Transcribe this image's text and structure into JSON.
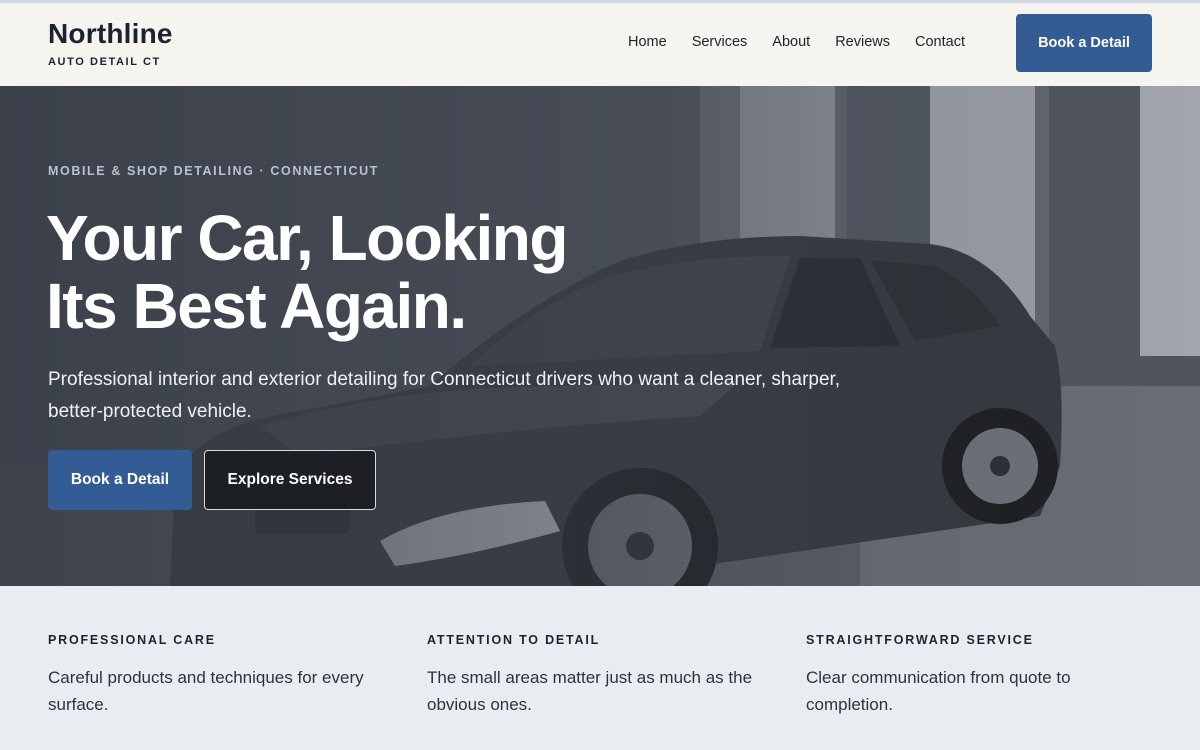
{
  "header": {
    "brand_name": "Northline",
    "brand_sub": "AUTO DETAIL CT",
    "nav": [
      "Home",
      "Services",
      "About",
      "Reviews",
      "Contact"
    ],
    "cta": "Book a Detail"
  },
  "hero": {
    "eyebrow": "MOBILE & SHOP DETAILING · CONNECTICUT",
    "title_line1": "Your Car, Looking",
    "title_line2": "Its Best Again.",
    "description": "Professional interior and exterior detailing for Connecticut drivers who want a cleaner, sharper, better-protected vehicle.",
    "primary_button": "Book a Detail",
    "secondary_button": "Explore Services"
  },
  "features": [
    {
      "title": "PROFESSIONAL CARE",
      "text": "Careful products and techniques for every surface."
    },
    {
      "title": "ATTENTION TO DETAIL",
      "text": "The small areas matter just as much as the obvious ones."
    },
    {
      "title": "STRAIGHTFORWARD SERVICE",
      "text": "Clear communication from quote to completion."
    }
  ],
  "colors": {
    "accent": "#335c94",
    "header_bg": "#f6f4ef",
    "features_bg": "#e9edf2",
    "text_dark": "#1d2330"
  },
  "icons": [
    "car-photo"
  ]
}
